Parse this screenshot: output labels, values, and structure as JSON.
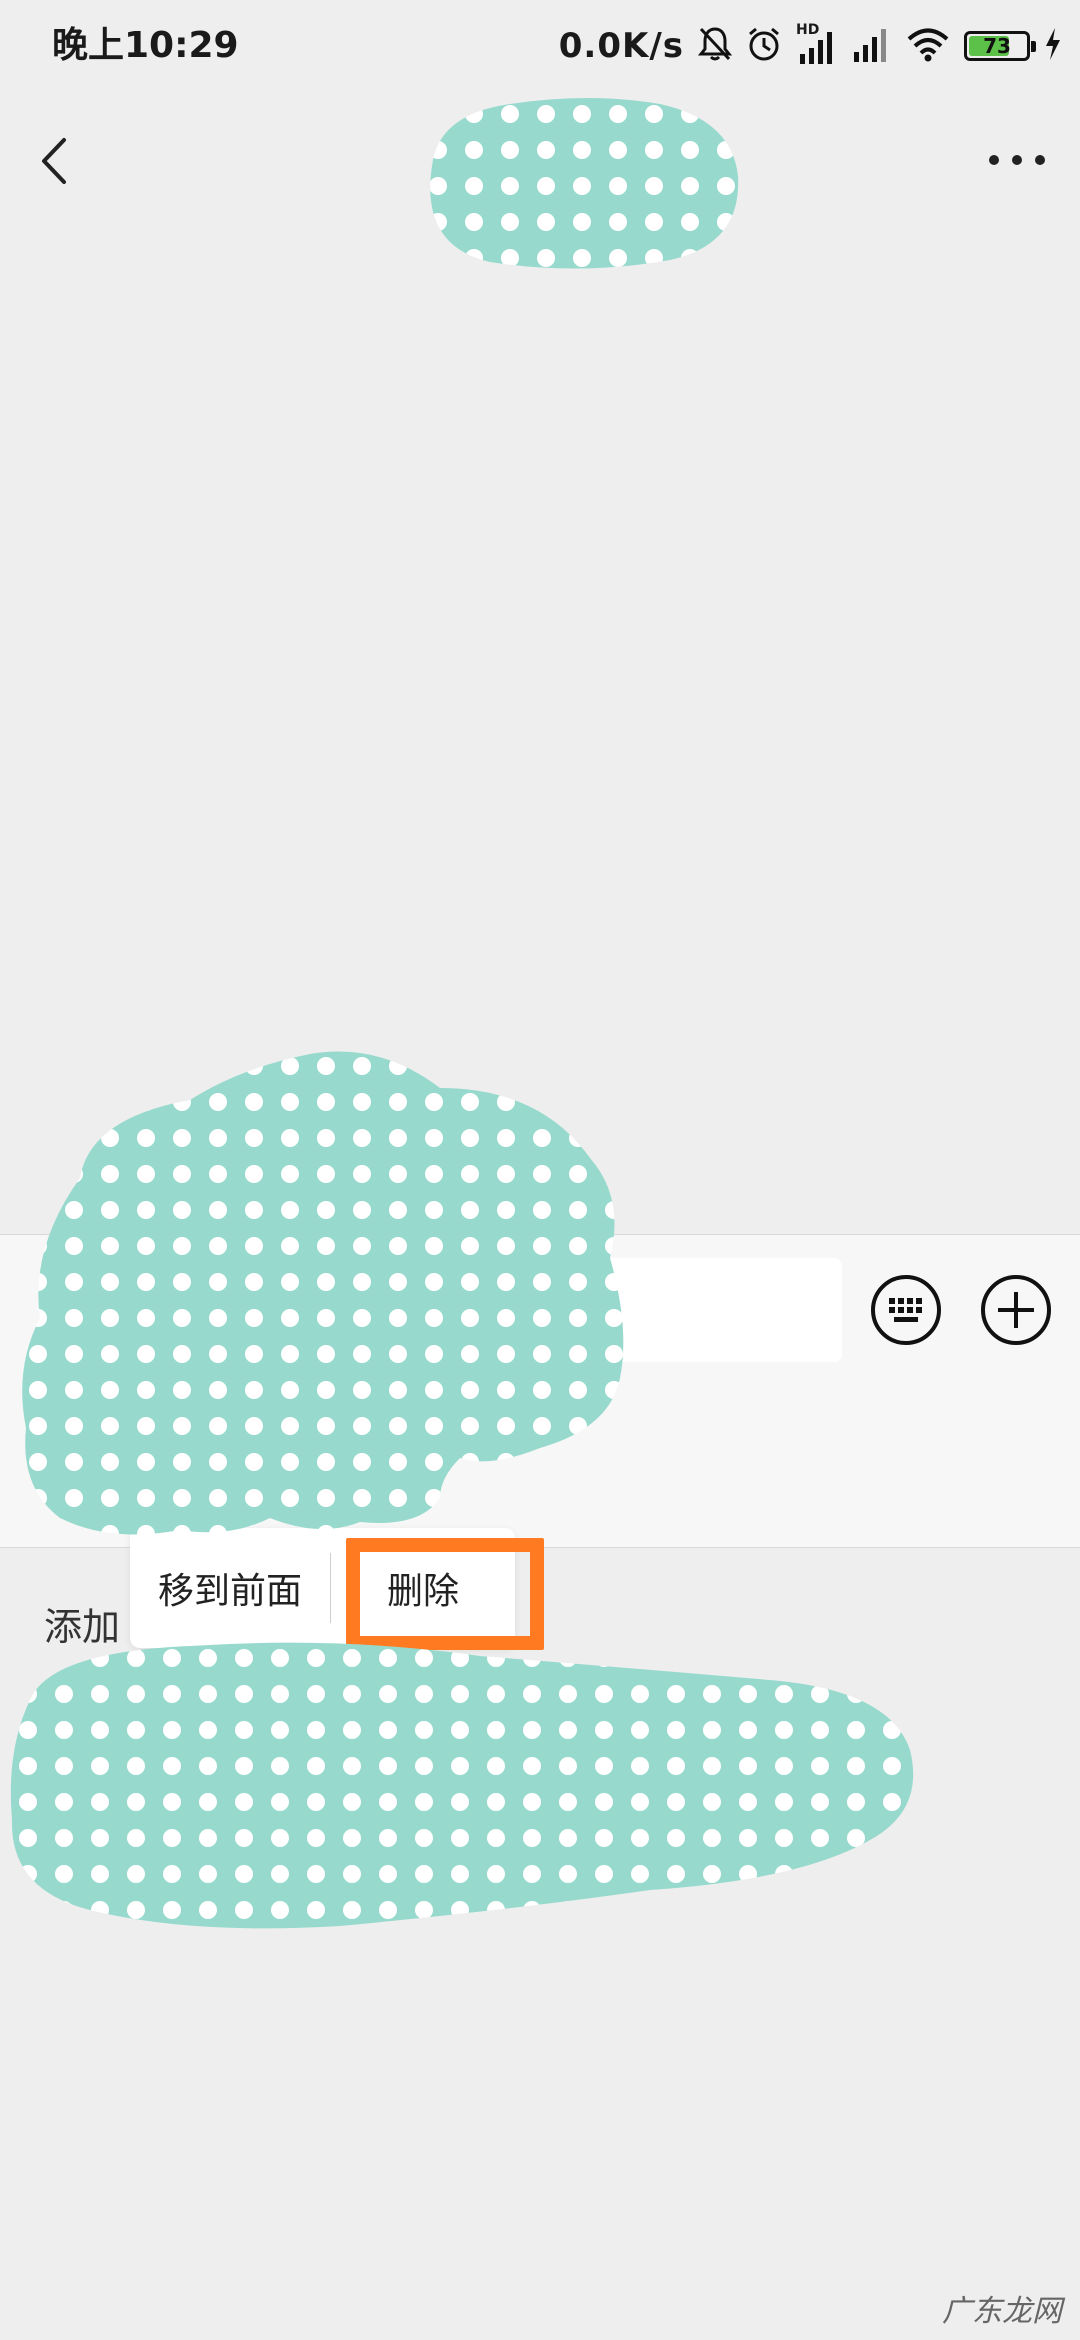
{
  "status_bar": {
    "time": "晚上10:29",
    "net_speed": "0.0K/s",
    "hd_label": "HD",
    "battery_level": "73",
    "battery_fraction": 0.73
  },
  "nav": {
    "back_icon": "chevron-left-icon",
    "more_icon": "more-horizontal-icon"
  },
  "input_bar": {
    "keyboard_icon": "keyboard-icon",
    "plus_icon": "plus-circle-icon"
  },
  "context_menu": {
    "items": [
      {
        "label": "移到前面"
      },
      {
        "label": "删除",
        "highlighted": true
      }
    ],
    "highlight_color": "#ff7a20"
  },
  "content": {
    "add_label": "添加"
  },
  "watermark": "广东龙网",
  "colors": {
    "background": "#eeeeee",
    "redaction_teal": "#97dacd",
    "battery_green": "#5cc148"
  }
}
